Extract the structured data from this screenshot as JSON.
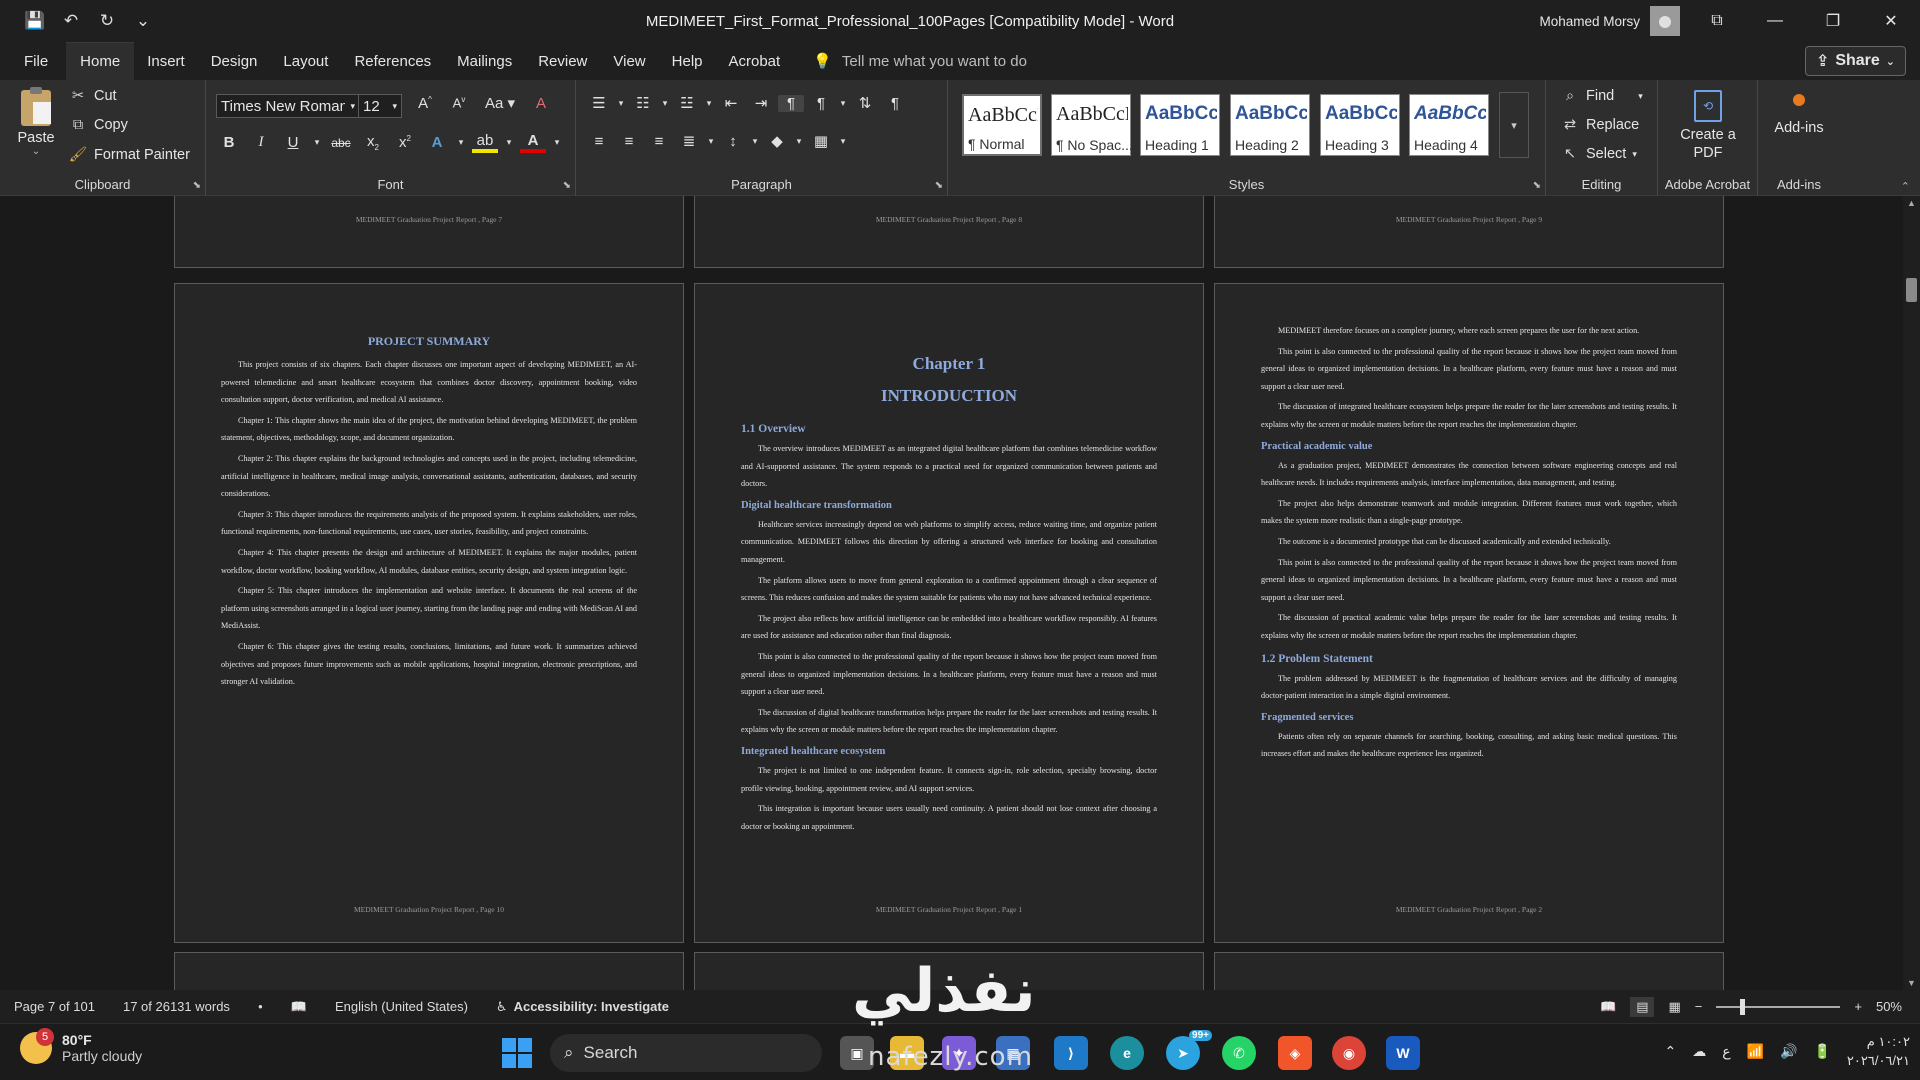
{
  "window": {
    "title": "MEDIMEET_First_Format_Professional_100Pages [Compatibility Mode]  -  Word",
    "user": "Mohamed Morsy"
  },
  "qat": {
    "save": "💾",
    "undo": "↶",
    "redo": "↻",
    "more": "⌄"
  },
  "menu": {
    "tabs": [
      "File",
      "Home",
      "Insert",
      "Design",
      "Layout",
      "References",
      "Mailings",
      "Review",
      "View",
      "Help",
      "Acrobat"
    ],
    "tell_me": "Tell me what you want to do",
    "share": "Share"
  },
  "ribbon": {
    "clipboard": {
      "paste": "Paste",
      "cut": "Cut",
      "copy": "Copy",
      "format_painter": "Format Painter",
      "label": "Clipboard"
    },
    "font": {
      "name": "Times New Roman",
      "size": "12",
      "label": "Font"
    },
    "paragraph": {
      "label": "Paragraph"
    },
    "styles": {
      "label": "Styles",
      "items": [
        {
          "preview": "AaBbCcI",
          "name": "¶ Normal"
        },
        {
          "preview": "AaBbCcDc",
          "name": "¶ No Spac..."
        },
        {
          "preview": "AaBbCcl",
          "name": "Heading 1"
        },
        {
          "preview": "AaBbCcD",
          "name": "Heading 2"
        },
        {
          "preview": "AaBbCcD",
          "name": "Heading 3"
        },
        {
          "preview": "AaBbCcD",
          "name": "Heading 4"
        }
      ]
    },
    "editing": {
      "find": "Find",
      "replace": "Replace",
      "select": "Select",
      "label": "Editing"
    },
    "acrobat": {
      "create_pdf": "Create a PDF",
      "label": "Adobe Acrobat"
    },
    "addins": {
      "button": "Add-ins",
      "label": "Add-ins"
    }
  },
  "pages": {
    "footer_prefix": "MEDIMEET Graduation Project Report , Page",
    "top_row": [
      "7",
      "8",
      "9"
    ],
    "summary": {
      "title": "PROJECT SUMMARY",
      "page": "10",
      "paragraphs": [
        "This project consists of six chapters. Each chapter discusses one important aspect of developing MEDIMEET, an AI-powered telemedicine and smart healthcare ecosystem that combines doctor discovery, appointment booking, video consultation support, doctor verification, and medical AI assistance.",
        "Chapter 1: This chapter shows the main idea of the project, the motivation behind developing MEDIMEET, the problem statement, objectives, methodology, scope, and document organization.",
        "Chapter 2: This chapter explains the background technologies and concepts used in the project, including telemedicine, artificial intelligence in healthcare, medical image analysis, conversational assistants, authentication, databases, and security considerations.",
        "Chapter 3: This chapter introduces the requirements analysis of the proposed system. It explains stakeholders, user roles, functional requirements, non-functional requirements, use cases, user stories, feasibility, and project constraints.",
        "Chapter 4: This chapter presents the design and architecture of MEDIMEET. It explains the major modules, patient workflow, doctor workflow, booking workflow, AI modules, database entities, security design, and system integration logic.",
        "Chapter 5: This chapter introduces the implementation and website interface. It documents the real screens of the platform using screenshots arranged in a logical user journey, starting from the landing page and ending with MediScan AI and MediAssist.",
        "Chapter 6: This chapter gives the testing results, conclusions, limitations, and future work. It summarizes achieved objectives and proposes future improvements such as mobile applications, hospital integration, electronic prescriptions, and stronger AI validation."
      ]
    },
    "chapter1": {
      "chapter": "Chapter 1",
      "title": "INTRODUCTION",
      "page": "1",
      "h_overview": "1.1 Overview",
      "p_overview": "The overview introduces MEDIMEET as an integrated digital healthcare platform that combines telemedicine workflow and AI-supported assistance. The system responds to a practical need for organized communication between patients and doctors.",
      "h_digital": "Digital healthcare transformation",
      "p_digital": [
        "Healthcare services increasingly depend on web platforms to simplify access, reduce waiting time, and organize patient communication. MEDIMEET follows this direction by offering a structured web interface for booking and consultation management.",
        "The platform allows users to move from general exploration to a confirmed appointment through a clear sequence of screens. This reduces confusion and makes the system suitable for patients who may not have advanced technical experience.",
        "The project also reflects how artificial intelligence can be embedded into a healthcare workflow responsibly. AI features are used for assistance and education rather than final diagnosis.",
        "This point is also connected to the professional quality of the report because it shows how the project team moved from general ideas to organized implementation decisions. In a healthcare platform, every feature must have a reason and must support a clear user need.",
        "The discussion of digital healthcare transformation helps prepare the reader for the later screenshots and testing results. It explains why the screen or module matters before the report reaches the implementation chapter."
      ],
      "h_integrated": "Integrated healthcare ecosystem",
      "p_integrated": [
        "The project is not limited to one independent feature. It connects sign-in, role selection, specialty browsing, doctor profile viewing, booking, appointment review, and AI support services.",
        "This integration is important because users usually need continuity. A patient should not lose context after choosing a doctor or booking an appointment."
      ]
    },
    "page2": {
      "page": "2",
      "p_intro": [
        "MEDIMEET therefore focuses on a complete journey, where each screen prepares the user for the next action.",
        "This point is also connected to the professional quality of the report because it shows how the project team moved from general ideas to organized implementation decisions. In a healthcare platform, every feature must have a reason and must support a clear user need.",
        "The discussion of integrated healthcare ecosystem helps prepare the reader for the later screenshots and testing results. It explains why the screen or module matters before the report reaches the implementation chapter."
      ],
      "h_practical": "Practical academic value",
      "p_practical": [
        "As a graduation project, MEDIMEET demonstrates the connection between software engineering concepts and real healthcare needs. It includes requirements analysis, interface implementation, data management, and testing.",
        "The project also helps demonstrate teamwork and module integration. Different features must work together, which makes the system more realistic than a single-page prototype.",
        "The outcome is a documented prototype that can be discussed academically and extended technically.",
        "This point is also connected to the professional quality of the report because it shows how the project team moved from general ideas to organized implementation decisions. In a healthcare platform, every feature must have a reason and must support a clear user need.",
        "The discussion of practical academic value helps prepare the reader for the later screenshots and testing results. It explains why the screen or module matters before the report reaches the implementation chapter."
      ],
      "h_problem": "1.2 Problem Statement",
      "p_problem": "The problem addressed by MEDIMEET is the fragmentation of healthcare services and the difficulty of managing doctor-patient interaction in a simple digital environment.",
      "h_fragmented": "Fragmented services",
      "p_fragmented": "Patients often rely on separate channels for searching, booking, consulting, and asking basic medical questions. This increases effort and makes the healthcare experience less organized."
    }
  },
  "status": {
    "page": "Page 7 of 101",
    "words": "17 of 26131 words",
    "language": "English (United States)",
    "accessibility": "Accessibility: Investigate",
    "zoom": "50%"
  },
  "taskbar": {
    "temp": "80°F",
    "weather": "Partly cloudy",
    "weather_badge": "5",
    "search": "Search",
    "telegram_badge": "99+",
    "time": "١٠:٠٢ م",
    "date": "٢٠٢٦/٠٦/٢١",
    "ime": "ع"
  },
  "watermark": {
    "main": "نفذلي",
    "sub": "nafezly.com"
  }
}
